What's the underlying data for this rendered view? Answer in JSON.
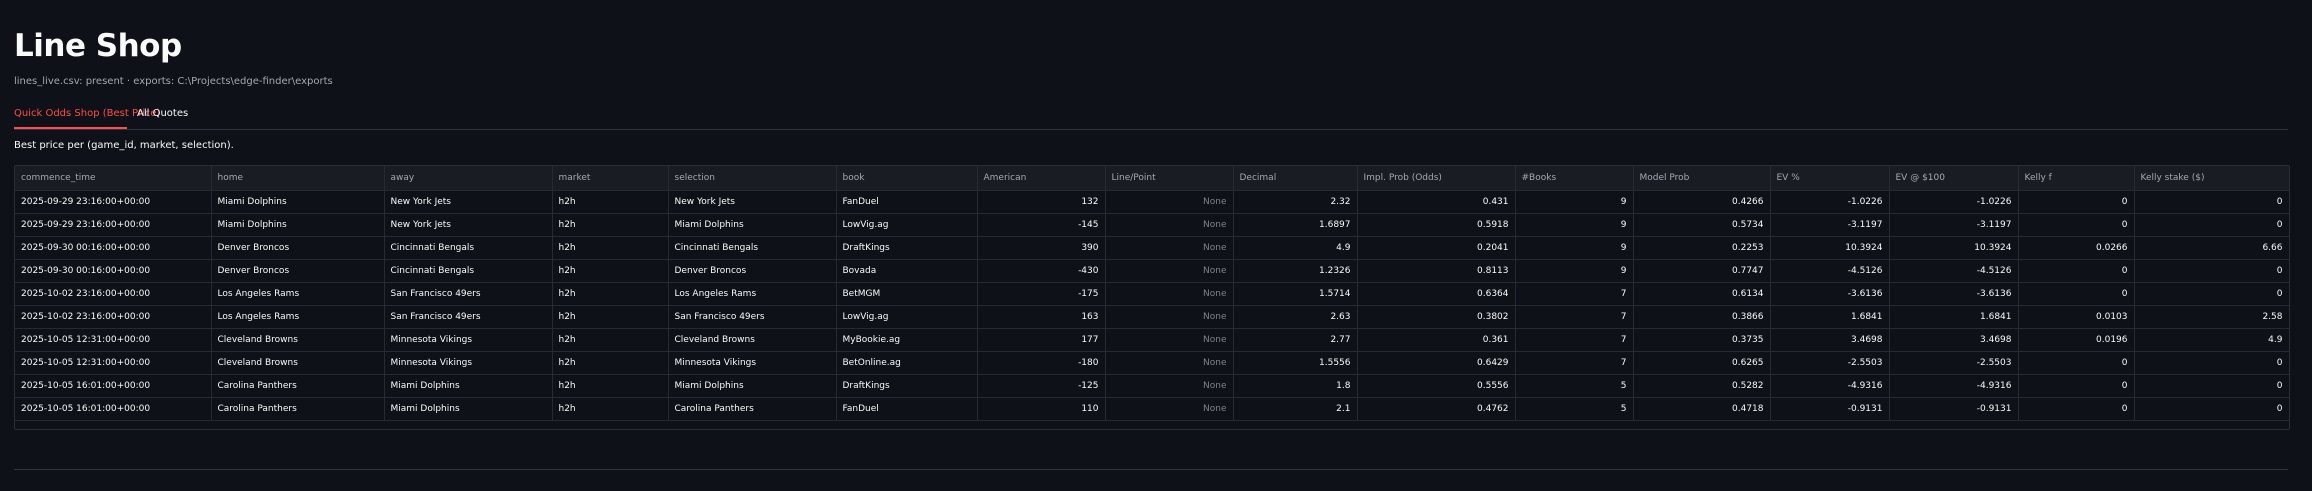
{
  "page": {
    "title": "Line Shop",
    "caption": "lines_live.csv: present · exports: C:\\Projects\\edge-finder\\exports",
    "description": "Best price per (game_id, market, selection)."
  },
  "tabs": [
    {
      "label": "Quick Odds Shop (Best Price)",
      "active": true
    },
    {
      "label": "All Quotes",
      "active": false
    }
  ],
  "colors": {
    "background": "#0e1117",
    "accent": "#ff4b4b",
    "text": "#fafafa",
    "muted": "#a3a8b4"
  },
  "table": {
    "columns": [
      "commence_time",
      "home",
      "away",
      "market",
      "selection",
      "book",
      "American",
      "Line/Point",
      "Decimal",
      "Impl. Prob (Odds)",
      "#Books",
      "Model Prob",
      "EV %",
      "EV @ $100",
      "Kelly f",
      "Kelly stake ($)"
    ],
    "rows": [
      [
        "2025-09-29 23:16:00+00:00",
        "Miami Dolphins",
        "New York Jets",
        "h2h",
        "New York Jets",
        "FanDuel",
        "132",
        "None",
        "2.32",
        "0.431",
        "9",
        "0.4266",
        "-1.0226",
        "-1.0226",
        "0",
        "0"
      ],
      [
        "2025-09-29 23:16:00+00:00",
        "Miami Dolphins",
        "New York Jets",
        "h2h",
        "Miami Dolphins",
        "LowVig.ag",
        "-145",
        "None",
        "1.6897",
        "0.5918",
        "9",
        "0.5734",
        "-3.1197",
        "-3.1197",
        "0",
        "0"
      ],
      [
        "2025-09-30 00:16:00+00:00",
        "Denver Broncos",
        "Cincinnati Bengals",
        "h2h",
        "Cincinnati Bengals",
        "DraftKings",
        "390",
        "None",
        "4.9",
        "0.2041",
        "9",
        "0.2253",
        "10.3924",
        "10.3924",
        "0.0266",
        "6.66"
      ],
      [
        "2025-09-30 00:16:00+00:00",
        "Denver Broncos",
        "Cincinnati Bengals",
        "h2h",
        "Denver Broncos",
        "Bovada",
        "-430",
        "None",
        "1.2326",
        "0.8113",
        "9",
        "0.7747",
        "-4.5126",
        "-4.5126",
        "0",
        "0"
      ],
      [
        "2025-10-02 23:16:00+00:00",
        "Los Angeles Rams",
        "San Francisco 49ers",
        "h2h",
        "Los Angeles Rams",
        "BetMGM",
        "-175",
        "None",
        "1.5714",
        "0.6364",
        "7",
        "0.6134",
        "-3.6136",
        "-3.6136",
        "0",
        "0"
      ],
      [
        "2025-10-02 23:16:00+00:00",
        "Los Angeles Rams",
        "San Francisco 49ers",
        "h2h",
        "San Francisco 49ers",
        "LowVig.ag",
        "163",
        "None",
        "2.63",
        "0.3802",
        "7",
        "0.3866",
        "1.6841",
        "1.6841",
        "0.0103",
        "2.58"
      ],
      [
        "2025-10-05 12:31:00+00:00",
        "Cleveland Browns",
        "Minnesota Vikings",
        "h2h",
        "Cleveland Browns",
        "MyBookie.ag",
        "177",
        "None",
        "2.77",
        "0.361",
        "7",
        "0.3735",
        "3.4698",
        "3.4698",
        "0.0196",
        "4.9"
      ],
      [
        "2025-10-05 12:31:00+00:00",
        "Cleveland Browns",
        "Minnesota Vikings",
        "h2h",
        "Minnesota Vikings",
        "BetOnline.ag",
        "-180",
        "None",
        "1.5556",
        "0.6429",
        "7",
        "0.6265",
        "-2.5503",
        "-2.5503",
        "0",
        "0"
      ],
      [
        "2025-10-05 16:01:00+00:00",
        "Carolina Panthers",
        "Miami Dolphins",
        "h2h",
        "Miami Dolphins",
        "DraftKings",
        "-125",
        "None",
        "1.8",
        "0.5556",
        "5",
        "0.5282",
        "-4.9316",
        "-4.9316",
        "0",
        "0"
      ],
      [
        "2025-10-05 16:01:00+00:00",
        "Carolina Panthers",
        "Miami Dolphins",
        "h2h",
        "Carolina Panthers",
        "FanDuel",
        "110",
        "None",
        "2.1",
        "0.4762",
        "5",
        "0.4718",
        "-0.9131",
        "-0.9131",
        "0",
        "0"
      ]
    ]
  }
}
